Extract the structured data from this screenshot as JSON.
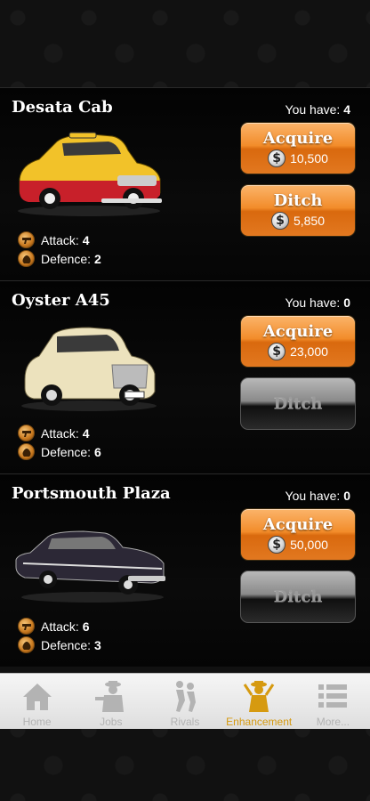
{
  "items": [
    {
      "name": "Desata Cab",
      "have_label": "You have:",
      "have_count": "4",
      "attack_label": "Attack:",
      "attack_value": "4",
      "defence_label": "Defence:",
      "defence_value": "2",
      "acquire_label": "Acquire",
      "acquire_price": "10,500",
      "ditch_label": "Ditch",
      "ditch_price": "5,850",
      "car_colors": {
        "body": "#f2c229",
        "lower": "#c8202a"
      }
    },
    {
      "name": "Oyster A45",
      "have_label": "You have:",
      "have_count": "0",
      "attack_label": "Attack:",
      "attack_value": "4",
      "defence_label": "Defence:",
      "defence_value": "6",
      "acquire_label": "Acquire",
      "acquire_price": "23,000",
      "ditch_label": "Ditch",
      "car_colors": {
        "body": "#ece2bd",
        "lower": "#d9cfa6"
      }
    },
    {
      "name": "Portsmouth Plaza",
      "have_label": "You have:",
      "have_count": "0",
      "attack_label": "Attack:",
      "attack_value": "6",
      "defence_label": "Defence:",
      "defence_value": "3",
      "acquire_label": "Acquire",
      "acquire_price": "50,000",
      "ditch_label": "Ditch",
      "car_colors": {
        "body": "#2c2836",
        "lower": "#3a3446"
      }
    }
  ],
  "tabs": [
    {
      "label": "Home",
      "icon": "home-icon"
    },
    {
      "label": "Jobs",
      "icon": "gangster-icon"
    },
    {
      "label": "Rivals",
      "icon": "fight-icon"
    },
    {
      "label": "Enhancement",
      "icon": "tommy-gun-icon",
      "active": true
    },
    {
      "label": "More...",
      "icon": "list-icon"
    }
  ],
  "colors": {
    "accent": "#d69a10",
    "button_orange": "#f28c2a",
    "inactive_tab": "#b3b3b3"
  },
  "currency_symbol": "$"
}
